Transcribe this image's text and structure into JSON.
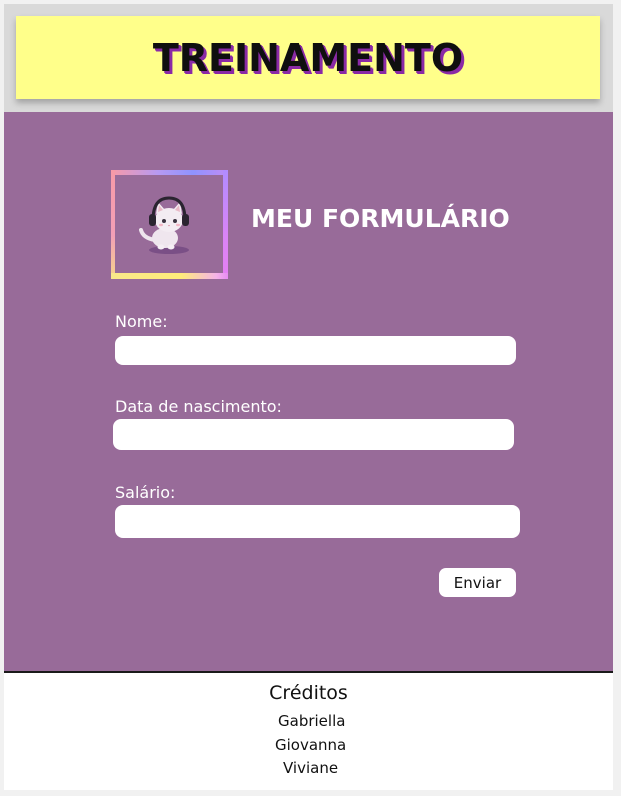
{
  "header": {
    "title": "TREINAMENTO"
  },
  "form": {
    "title": "MEU FORMULÁRIO",
    "logo_icon": "cat-with-headphones-icon",
    "fields": [
      {
        "label": "Nome:",
        "value": ""
      },
      {
        "label": "Data de nascimento:",
        "value": ""
      },
      {
        "label": "Salário:",
        "value": ""
      }
    ],
    "submit_label": "Enviar"
  },
  "footer": {
    "credits_title": "Créditos",
    "names": [
      "Gabriella",
      "Giovanna",
      "Viviane"
    ]
  },
  "colors": {
    "header_bg": "#ffff8a",
    "main_bg": "#986b99",
    "title_shadow": "#8a2aa6"
  }
}
